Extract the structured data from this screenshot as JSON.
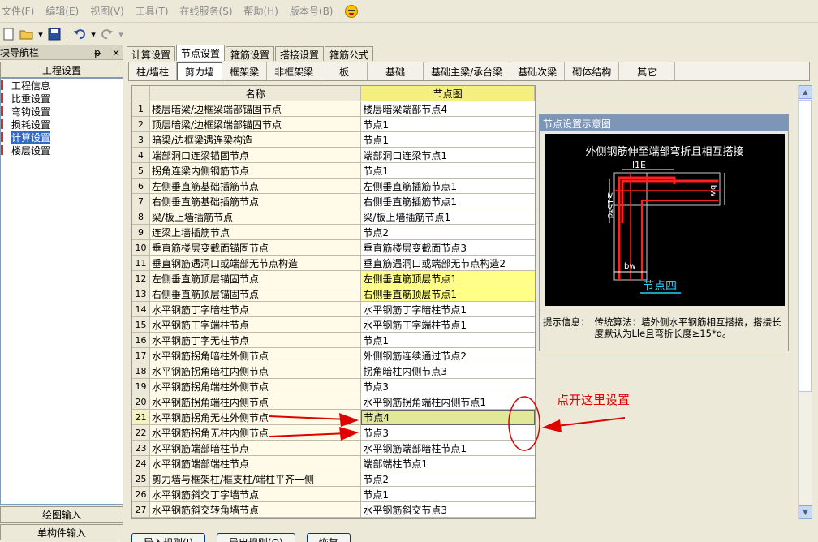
{
  "menu": [
    "文件(F)",
    "编辑(E)",
    "视图(V)",
    "工具(T)",
    "在线服务(S)",
    "帮助(H)",
    "版本号(B)"
  ],
  "nav": {
    "title": "块导航栏",
    "pin": "ᵽ",
    "close": "×",
    "section": "工程设置",
    "items": [
      "工程信息",
      "比重设置",
      "弯钩设置",
      "损耗设置",
      "计算设置",
      "楼层设置"
    ],
    "bottom": [
      "绘图输入",
      "单构件输入"
    ]
  },
  "tabs_main": [
    "计算设置",
    "节点设置",
    "箍筋设置",
    "搭接设置",
    "箍筋公式"
  ],
  "tabs_sub": [
    "柱/墙柱",
    "剪力墙",
    "框架梁",
    "非框架梁",
    "板",
    "基础",
    "基础主梁/承台梁",
    "基础次梁",
    "砌体结构",
    "其它"
  ],
  "grid": {
    "col_name": "名称",
    "col_node": "节点图",
    "rows": [
      {
        "n": "1",
        "name": "楼层暗梁/边框梁端部锚固节点",
        "node": "楼层暗梁端部节点4"
      },
      {
        "n": "2",
        "name": "顶层暗梁/边框梁端部锚固节点",
        "node": "节点1"
      },
      {
        "n": "3",
        "name": "暗梁/边框梁遇连梁构造",
        "node": "节点1"
      },
      {
        "n": "4",
        "name": "端部洞口连梁锚固节点",
        "node": "端部洞口连梁节点1"
      },
      {
        "n": "5",
        "name": "拐角连梁内侧钢筋节点",
        "node": "节点1"
      },
      {
        "n": "6",
        "name": "左侧垂直筋基础插筋节点",
        "node": "左侧垂直筋插筋节点1"
      },
      {
        "n": "7",
        "name": "右侧垂直筋基础插筋节点",
        "node": "右侧垂直筋插筋节点1"
      },
      {
        "n": "8",
        "name": "梁/板上墙插筋节点",
        "node": "梁/板上墙插筋节点1"
      },
      {
        "n": "9",
        "name": "连梁上墙插筋节点",
        "node": "节点2"
      },
      {
        "n": "10",
        "name": "垂直筋楼层变截面锚固节点",
        "node": "垂直筋楼层变截面节点3"
      },
      {
        "n": "11",
        "name": "垂直钢筋遇洞口或端部无节点构造",
        "node": "垂直筋遇洞口或端部无节点构造2"
      },
      {
        "n": "12",
        "name": "左侧垂直筋顶层锚固节点",
        "node": "左侧垂直筋顶层节点1"
      },
      {
        "n": "13",
        "name": "右侧垂直筋顶层锚固节点",
        "node": "右侧垂直筋顶层节点1"
      },
      {
        "n": "14",
        "name": "水平钢筋丁字暗柱节点",
        "node": "水平钢筋丁字暗柱节点1"
      },
      {
        "n": "15",
        "name": "水平钢筋丁字端柱节点",
        "node": "水平钢筋丁字端柱节点1"
      },
      {
        "n": "16",
        "name": "水平钢筋丁字无柱节点",
        "node": "节点1"
      },
      {
        "n": "17",
        "name": "水平钢筋拐角暗柱外侧节点",
        "node": "外侧钢筋连续通过节点2"
      },
      {
        "n": "18",
        "name": "水平钢筋拐角暗柱内侧节点",
        "node": "拐角暗柱内侧节点3"
      },
      {
        "n": "19",
        "name": "水平钢筋拐角端柱外侧节点",
        "node": "节点3"
      },
      {
        "n": "20",
        "name": "水平钢筋拐角端柱内侧节点",
        "node": "水平钢筋拐角端柱内侧节点1"
      },
      {
        "n": "21",
        "name": "水平钢筋拐角无柱外侧节点",
        "node": "节点4"
      },
      {
        "n": "22",
        "name": "水平钢筋拐角无柱内侧节点",
        "node": "节点3"
      },
      {
        "n": "23",
        "name": "水平钢筋端部暗柱节点",
        "node": "水平钢筋端部暗柱节点1"
      },
      {
        "n": "24",
        "name": "水平钢筋端部端柱节点",
        "node": "端部端柱节点1"
      },
      {
        "n": "25",
        "name": "剪力墙与框架柱/框支柱/端柱平齐一侧",
        "node": "节点2"
      },
      {
        "n": "26",
        "name": "水平钢筋斜交丁字墙节点",
        "node": "节点1"
      },
      {
        "n": "27",
        "name": "水平钢筋斜交转角墙节点",
        "node": "水平钢筋斜交节点3"
      }
    ]
  },
  "panel": {
    "title": "节点设置示意图",
    "diagram_title": "外侧钢筋伸至端部弯折且相互搭接",
    "label_lle": "l1E",
    "label_15d": "≥15*d",
    "label_bw_right": "bw",
    "label_bw_bottom": "bw",
    "diagram_caption": "节点四",
    "tip_label": "提示信息：",
    "tip_text": "传统算法：墙外侧水平钢筋相互搭接，搭接长度默认为Lle且弯折长度≥15*d。"
  },
  "annotation": "点开这里设置",
  "bottom_buttons": [
    "导入规则(I)",
    "导出规则(O)",
    "恢复"
  ],
  "colors": {
    "annotation": "#e00000",
    "highlight": "#ffff88",
    "selected": "#e2e89a",
    "rebar": "#ff2020"
  }
}
